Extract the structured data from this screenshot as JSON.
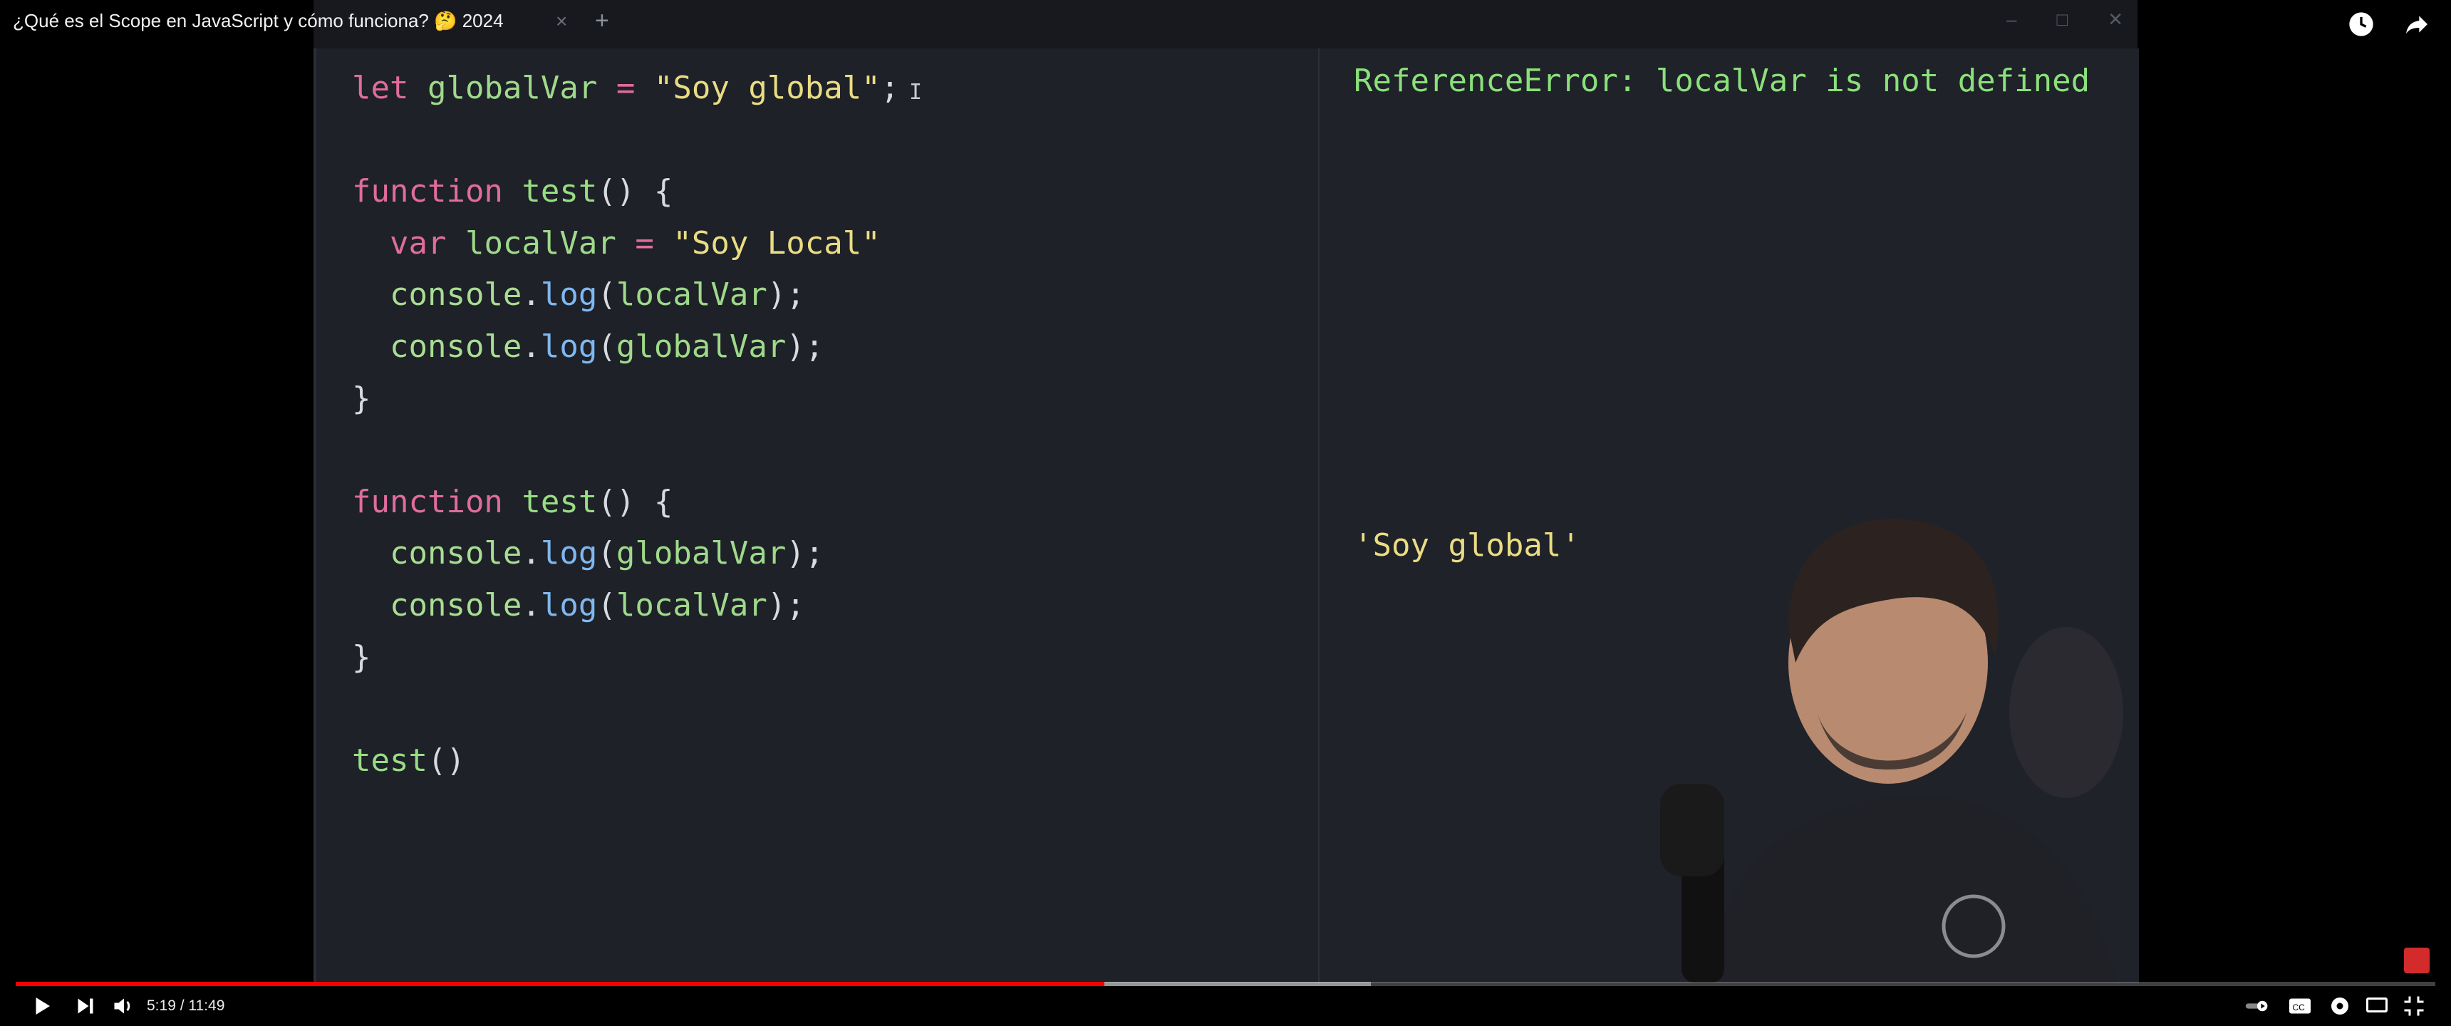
{
  "video": {
    "title": "¿Qué es el Scope en JavaScript y cómo funciona? 🤔 2024",
    "time_current": "5:19",
    "time_sep": " / ",
    "time_total": "11:49",
    "progress_fraction": 0.45,
    "buffered_fraction": 0.56
  },
  "editor": {
    "tab_close": "×",
    "tab_add": "+",
    "win_minimize": "–",
    "win_maximize": "□",
    "win_close": "✕",
    "cursor": "I"
  },
  "code_lines": [
    [
      {
        "t": "let ",
        "c": "kw"
      },
      {
        "t": "globalVar",
        "c": "var"
      },
      {
        "t": " = ",
        "c": "kw"
      },
      {
        "t": "\"Soy global\"",
        "c": "str"
      },
      {
        "t": ";",
        "c": "punc"
      }
    ],
    [],
    [
      {
        "t": "function ",
        "c": "kw"
      },
      {
        "t": "test",
        "c": "fn"
      },
      {
        "t": "() {",
        "c": "punc"
      }
    ],
    [
      {
        "t": "  var ",
        "c": "kw"
      },
      {
        "t": "localVar",
        "c": "var"
      },
      {
        "t": " = ",
        "c": "kw"
      },
      {
        "t": "\"Soy Local\"",
        "c": "str"
      }
    ],
    [
      {
        "t": "  console",
        "c": "obj"
      },
      {
        "t": ".",
        "c": "punc"
      },
      {
        "t": "log",
        "c": "method"
      },
      {
        "t": "(",
        "c": "punc"
      },
      {
        "t": "localVar",
        "c": "var"
      },
      {
        "t": ");",
        "c": "punc"
      }
    ],
    [
      {
        "t": "  console",
        "c": "obj"
      },
      {
        "t": ".",
        "c": "punc"
      },
      {
        "t": "log",
        "c": "method"
      },
      {
        "t": "(",
        "c": "punc"
      },
      {
        "t": "globalVar",
        "c": "var"
      },
      {
        "t": ");",
        "c": "punc"
      }
    ],
    [
      {
        "t": "}",
        "c": "punc"
      }
    ],
    [],
    [
      {
        "t": "function ",
        "c": "kw"
      },
      {
        "t": "test",
        "c": "fn"
      },
      {
        "t": "() {",
        "c": "punc"
      }
    ],
    [
      {
        "t": "  console",
        "c": "obj"
      },
      {
        "t": ".",
        "c": "punc"
      },
      {
        "t": "log",
        "c": "method"
      },
      {
        "t": "(",
        "c": "punc"
      },
      {
        "t": "globalVar",
        "c": "var"
      },
      {
        "t": ");",
        "c": "punc"
      }
    ],
    [
      {
        "t": "  console",
        "c": "obj"
      },
      {
        "t": ".",
        "c": "punc"
      },
      {
        "t": "log",
        "c": "method"
      },
      {
        "t": "(",
        "c": "punc"
      },
      {
        "t": "localVar",
        "c": "var"
      },
      {
        "t": ");",
        "c": "punc"
      }
    ],
    [
      {
        "t": "}",
        "c": "punc"
      }
    ],
    [],
    [
      {
        "t": "test",
        "c": "fn"
      },
      {
        "t": "()",
        "c": "punc"
      }
    ]
  ],
  "console": {
    "error": "ReferenceError: localVar is not defined",
    "output": "'Soy global'"
  },
  "icons": {
    "watch_later": "clock-icon",
    "share": "share-icon",
    "play": "play-icon",
    "next": "next-icon",
    "volume": "volume-icon",
    "autoplay": "autoplay-toggle-icon",
    "captions": "cc-icon",
    "settings": "settings-icon",
    "cast": "cast-icon",
    "fullscreen_exit": "exit-fullscreen-icon"
  },
  "colors": {
    "progress_played": "#ff0000",
    "keyword": "#e06c9f",
    "string": "#eadc83",
    "identifier": "#9fd98a",
    "method": "#7fb8f0",
    "console_error": "#8be07a"
  }
}
